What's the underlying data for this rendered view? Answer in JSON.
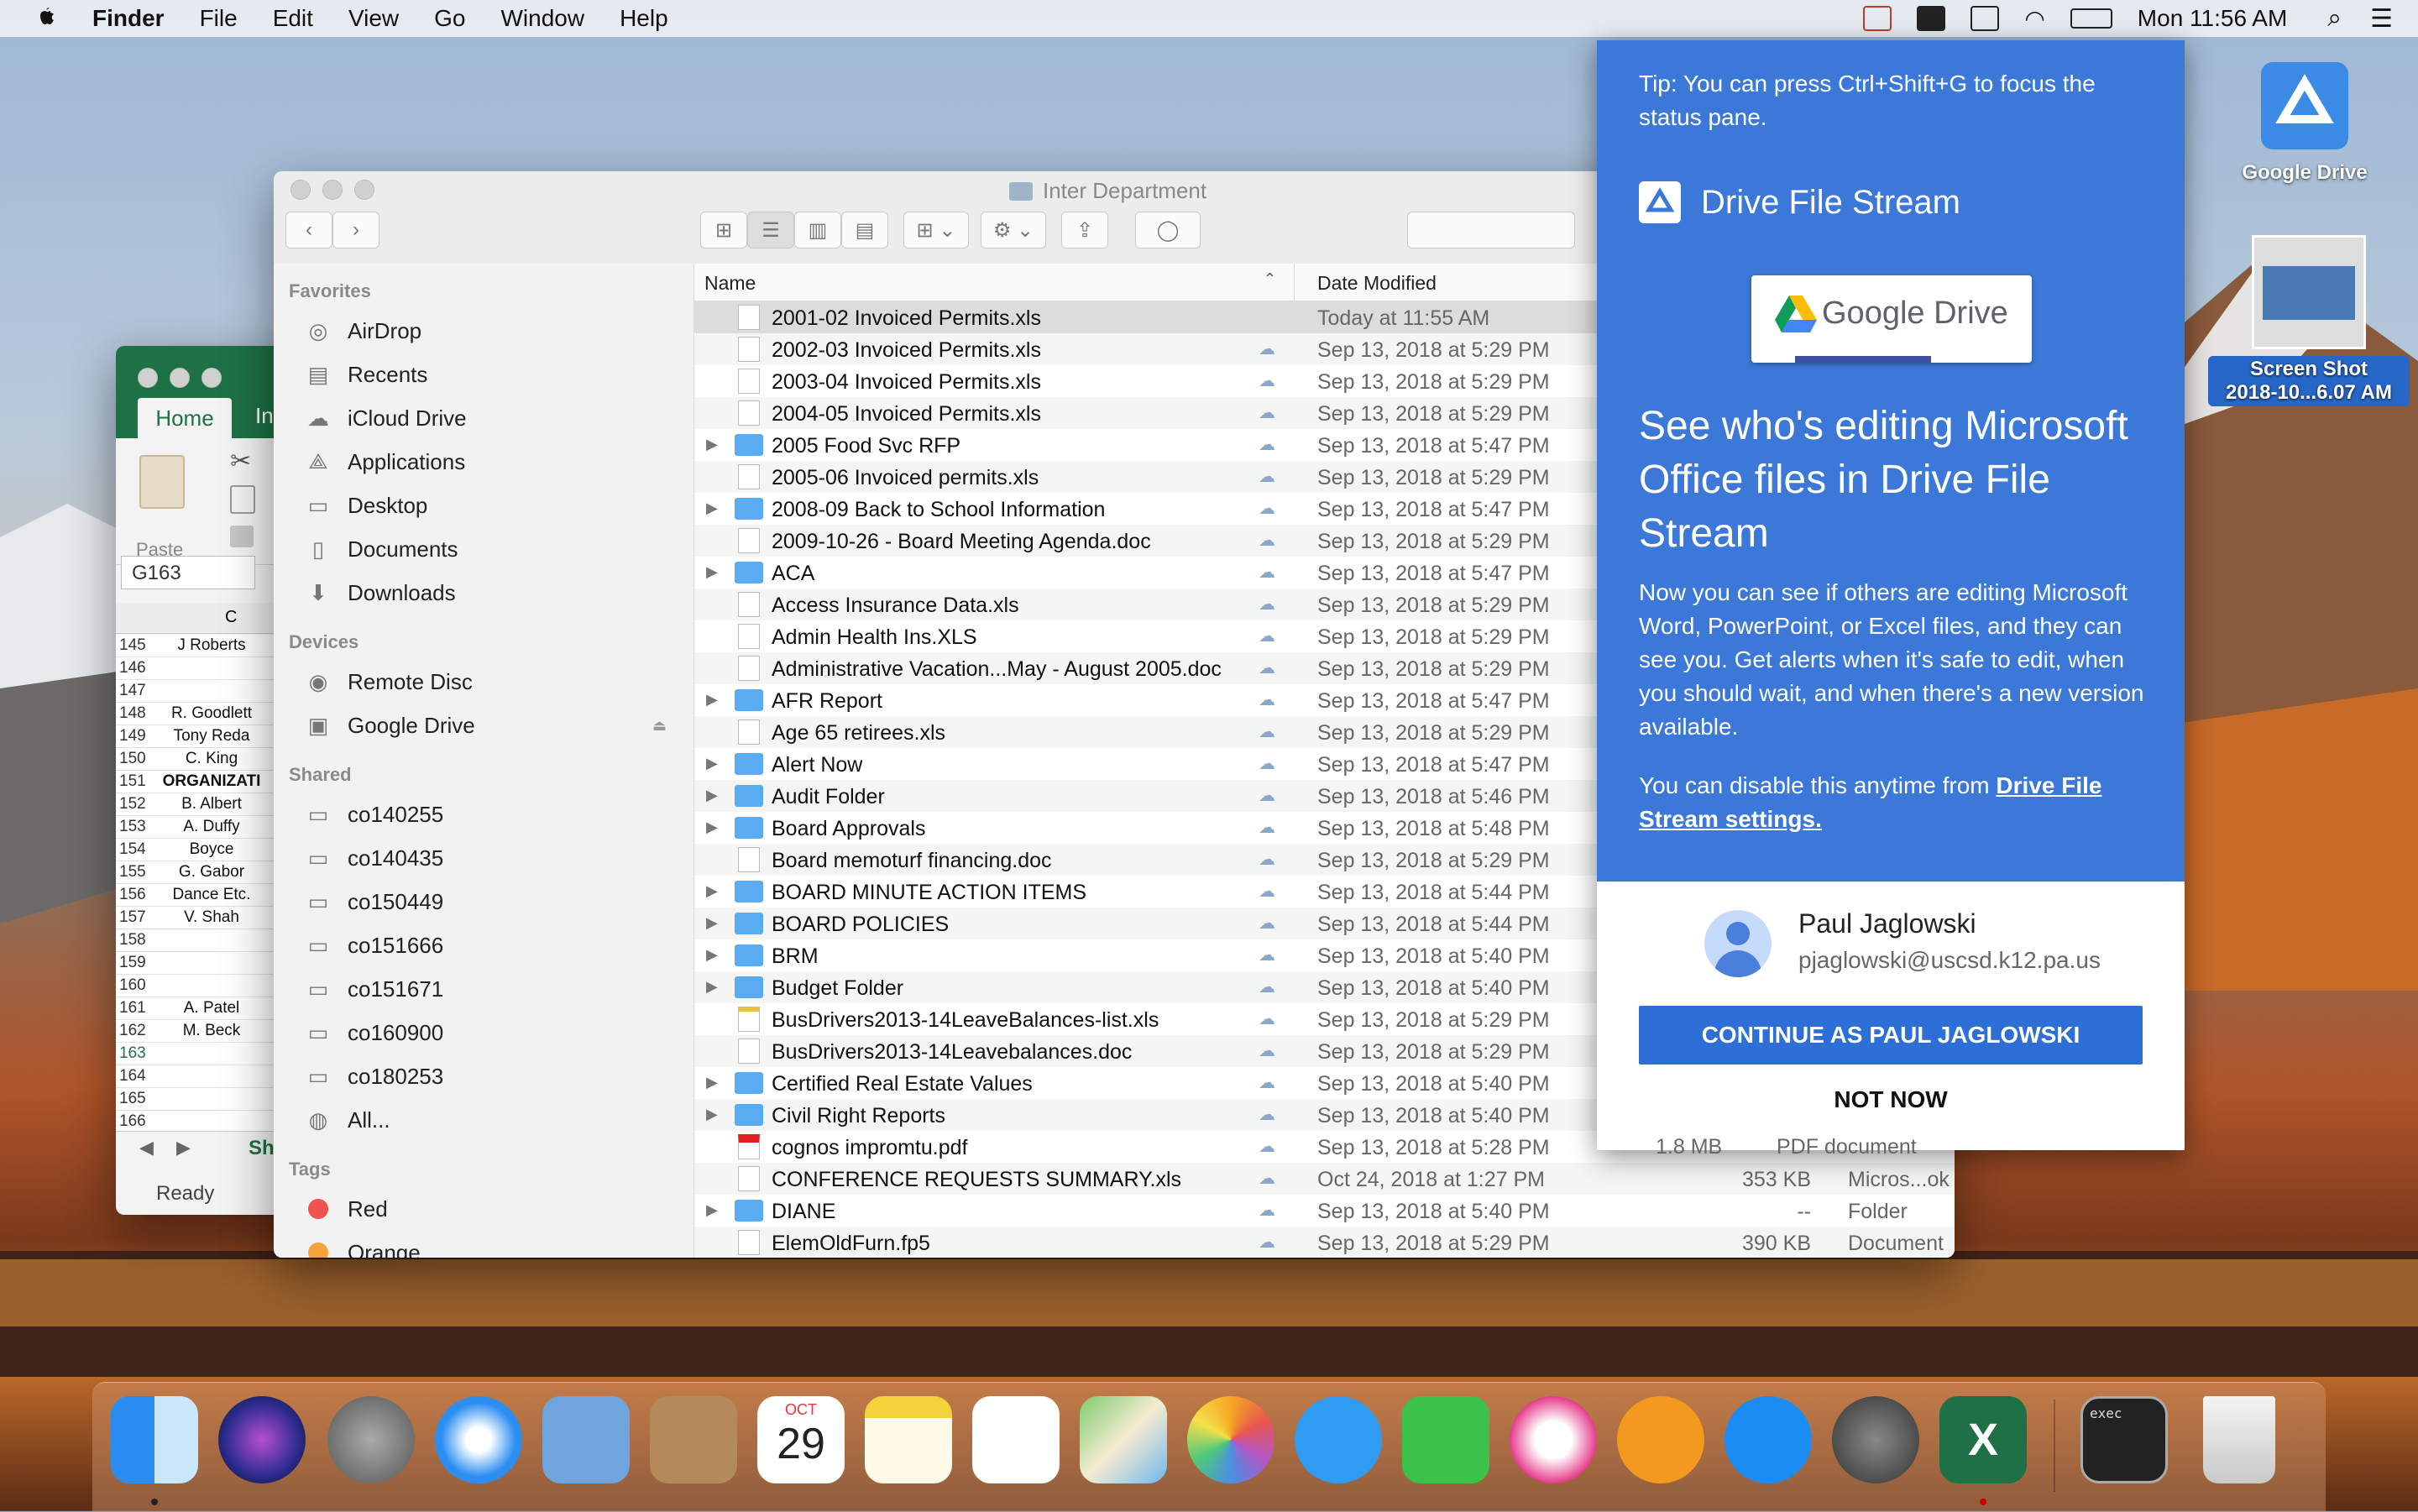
{
  "menubar": {
    "app_name": "Finder",
    "items": [
      "File",
      "Edit",
      "View",
      "Go",
      "Window",
      "Help"
    ],
    "clock": "Mon 11:56 AM",
    "tray_icons": [
      "google-drive-error-icon",
      "google-drive-icon",
      "airplay-icon",
      "wifi-icon",
      "battery-icon",
      "spotlight-icon",
      "notification-center-icon"
    ]
  },
  "excel": {
    "tab_home": "Home",
    "tab_next": "In",
    "paste_label": "Paste",
    "name_box": "G163",
    "column": "C",
    "rows": [
      {
        "n": "145",
        "v": "J Roberts",
        "b": false
      },
      {
        "n": "146",
        "v": "",
        "b": false
      },
      {
        "n": "147",
        "v": "",
        "b": false
      },
      {
        "n": "148",
        "v": "R. Goodlett",
        "b": false
      },
      {
        "n": "149",
        "v": "Tony Reda",
        "b": false
      },
      {
        "n": "150",
        "v": "C. King",
        "b": false
      },
      {
        "n": "151",
        "v": "ORGANIZATI",
        "b": true
      },
      {
        "n": "152",
        "v": "B. Albert",
        "b": false
      },
      {
        "n": "153",
        "v": "A. Duffy",
        "b": false
      },
      {
        "n": "154",
        "v": "Boyce",
        "b": false
      },
      {
        "n": "155",
        "v": "G. Gabor",
        "b": false
      },
      {
        "n": "156",
        "v": "Dance Etc.",
        "b": false
      },
      {
        "n": "157",
        "v": "V. Shah",
        "b": false
      },
      {
        "n": "158",
        "v": "",
        "b": false
      },
      {
        "n": "159",
        "v": "",
        "b": false
      },
      {
        "n": "160",
        "v": "",
        "b": false
      },
      {
        "n": "161",
        "v": "A. Patel",
        "b": false
      },
      {
        "n": "162",
        "v": "M. Beck",
        "b": false
      },
      {
        "n": "163",
        "v": "",
        "b": false
      },
      {
        "n": "164",
        "v": "",
        "b": false
      },
      {
        "n": "165",
        "v": "",
        "b": false
      },
      {
        "n": "166",
        "v": "",
        "b": false
      },
      {
        "n": "167",
        "v": "",
        "b": false
      }
    ],
    "sheet_tab": "Sh",
    "status": "Ready"
  },
  "finder": {
    "title": "Inter Department",
    "col_name": "Name",
    "col_date": "Date Modified",
    "sidebar": {
      "favorites_head": "Favorites",
      "favorites": [
        {
          "label": "AirDrop",
          "icon": "airdrop-icon"
        },
        {
          "label": "Recents",
          "icon": "recents-icon"
        },
        {
          "label": "iCloud Drive",
          "icon": "icloud-icon"
        },
        {
          "label": "Applications",
          "icon": "applications-icon"
        },
        {
          "label": "Desktop",
          "icon": "desktop-icon"
        },
        {
          "label": "Documents",
          "icon": "documents-icon"
        },
        {
          "label": "Downloads",
          "icon": "downloads-icon"
        }
      ],
      "devices_head": "Devices",
      "devices": [
        {
          "label": "Remote Disc",
          "icon": "disc-icon"
        },
        {
          "label": "Google Drive",
          "icon": "drive-icon"
        }
      ],
      "shared_head": "Shared",
      "shared": [
        {
          "label": "co140255",
          "icon": "computer-icon"
        },
        {
          "label": "co140435",
          "icon": "computer-icon"
        },
        {
          "label": "co150449",
          "icon": "computer-icon"
        },
        {
          "label": "co151666",
          "icon": "computer-icon"
        },
        {
          "label": "co151671",
          "icon": "computer-icon"
        },
        {
          "label": "co160900",
          "icon": "computer-icon"
        },
        {
          "label": "co180253",
          "icon": "computer-icon"
        },
        {
          "label": "All...",
          "icon": "network-icon"
        }
      ],
      "tags_head": "Tags",
      "tags": [
        {
          "label": "Red",
          "color": "#f0524f"
        },
        {
          "label": "Orange",
          "color": "#f5a33a"
        }
      ]
    },
    "files": [
      {
        "name": "2001-02 Invoiced Permits.xls",
        "type": "file",
        "date": "Today at 11:55 AM",
        "size": "",
        "kind": "",
        "folder": false
      },
      {
        "name": "2002-03 Invoiced Permits.xls",
        "type": "file",
        "date": "Sep 13, 2018 at 5:29 PM",
        "size": "",
        "kind": "",
        "folder": false
      },
      {
        "name": "2003-04 Invoiced Permits.xls",
        "type": "file",
        "date": "Sep 13, 2018 at 5:29 PM",
        "size": "",
        "kind": "",
        "folder": false
      },
      {
        "name": "2004-05 Invoiced Permits.xls",
        "type": "file",
        "date": "Sep 13, 2018 at 5:29 PM",
        "size": "",
        "kind": "",
        "folder": false
      },
      {
        "name": "2005 Food Svc RFP",
        "type": "folder",
        "date": "Sep 13, 2018 at 5:47 PM",
        "size": "",
        "kind": "",
        "folder": true
      },
      {
        "name": "2005-06 Invoiced permits.xls",
        "type": "file",
        "date": "Sep 13, 2018 at 5:29 PM",
        "size": "",
        "kind": "",
        "folder": false
      },
      {
        "name": "2008-09 Back to School Information",
        "type": "folder",
        "date": "Sep 13, 2018 at 5:47 PM",
        "size": "",
        "kind": "",
        "folder": true
      },
      {
        "name": "2009-10-26 - Board Meeting Agenda.doc",
        "type": "file",
        "date": "Sep 13, 2018 at 5:29 PM",
        "size": "",
        "kind": "",
        "folder": false
      },
      {
        "name": "ACA",
        "type": "folder",
        "date": "Sep 13, 2018 at 5:47 PM",
        "size": "",
        "kind": "",
        "folder": true
      },
      {
        "name": "Access Insurance Data.xls",
        "type": "file",
        "date": "Sep 13, 2018 at 5:29 PM",
        "size": "",
        "kind": "",
        "folder": false
      },
      {
        "name": "Admin Health Ins.XLS",
        "type": "file",
        "date": "Sep 13, 2018 at 5:29 PM",
        "size": "",
        "kind": "",
        "folder": false
      },
      {
        "name": "Administrative Vacation...May - August 2005.doc",
        "type": "file",
        "date": "Sep 13, 2018 at 5:29 PM",
        "size": "",
        "kind": "",
        "folder": false
      },
      {
        "name": "AFR Report",
        "type": "folder",
        "date": "Sep 13, 2018 at 5:47 PM",
        "size": "",
        "kind": "",
        "folder": true
      },
      {
        "name": "Age 65 retirees.xls",
        "type": "file",
        "date": "Sep 13, 2018 at 5:29 PM",
        "size": "",
        "kind": "",
        "folder": false
      },
      {
        "name": "Alert Now",
        "type": "folder",
        "date": "Sep 13, 2018 at 5:47 PM",
        "size": "",
        "kind": "",
        "folder": true
      },
      {
        "name": "Audit Folder",
        "type": "folder",
        "date": "Sep 13, 2018 at 5:46 PM",
        "size": "",
        "kind": "",
        "folder": true
      },
      {
        "name": "Board Approvals",
        "type": "folder",
        "date": "Sep 13, 2018 at 5:48 PM",
        "size": "",
        "kind": "",
        "folder": true
      },
      {
        "name": "Board memoturf financing.doc",
        "type": "file",
        "date": "Sep 13, 2018 at 5:29 PM",
        "size": "",
        "kind": "",
        "folder": false
      },
      {
        "name": "BOARD MINUTE ACTION ITEMS",
        "type": "folder",
        "date": "Sep 13, 2018 at 5:44 PM",
        "size": "",
        "kind": "",
        "folder": true
      },
      {
        "name": "BOARD POLICIES",
        "type": "folder",
        "date": "Sep 13, 2018 at 5:44 PM",
        "size": "",
        "kind": "",
        "folder": true
      },
      {
        "name": "BRM",
        "type": "folder",
        "date": "Sep 13, 2018 at 5:40 PM",
        "size": "",
        "kind": "",
        "folder": true
      },
      {
        "name": "Budget Folder",
        "type": "folder",
        "date": "Sep 13, 2018 at 5:40 PM",
        "size": "",
        "kind": "",
        "folder": true
      },
      {
        "name": "BusDrivers2013-14LeaveBalances-list.xls",
        "type": "xls",
        "date": "Sep 13, 2018 at 5:29 PM",
        "size": "",
        "kind": "",
        "folder": false
      },
      {
        "name": "BusDrivers2013-14Leavebalances.doc",
        "type": "file",
        "date": "Sep 13, 2018 at 5:29 PM",
        "size": "",
        "kind": "",
        "folder": false
      },
      {
        "name": "Certified Real Estate Values",
        "type": "folder",
        "date": "Sep 13, 2018 at 5:40 PM",
        "size": "",
        "kind": "",
        "folder": true
      },
      {
        "name": "Civil Right Reports",
        "type": "folder",
        "date": "Sep 13, 2018 at 5:40 PM",
        "size": "",
        "kind": "",
        "folder": true
      },
      {
        "name": "cognos impromtu.pdf",
        "type": "pdf",
        "date": "Sep 13, 2018 at 5:28 PM",
        "size": "",
        "kind": "",
        "folder": false
      },
      {
        "name": "CONFERENCE REQUESTS SUMMARY.xls",
        "type": "file",
        "date": "Oct 24, 2018 at 1:27 PM",
        "size": "353 KB",
        "kind": "Micros...ok (.xls)",
        "folder": false
      },
      {
        "name": "DIANE",
        "type": "folder",
        "date": "Sep 13, 2018 at 5:40 PM",
        "size": "--",
        "kind": "Folder",
        "folder": true
      },
      {
        "name": "ElemOldFurn.fp5",
        "type": "file",
        "date": "Sep 13, 2018 at 5:29 PM",
        "size": "390 KB",
        "kind": "Document",
        "folder": false
      }
    ]
  },
  "drive_popup": {
    "tip": "Tip: You can press Ctrl+Shift+G to focus the status pane.",
    "brand": "Drive File Stream",
    "card_text": "Google Drive",
    "headline": "See who's editing Microsoft Office files in Drive File Stream",
    "body": "Now you can see if others are editing Microsoft Word, PowerPoint, or Excel files, and they can see you. Get alerts when it's safe to edit, when you should wait, and when there's a new version available.",
    "disable_prefix": "You can disable this anytime from ",
    "disable_link": "Drive File Stream settings.",
    "user_name": "Paul Jaglowski",
    "user_email": "pjaglowski@uscsd.k12.pa.us",
    "continue_label": "CONTINUE AS PAUL JAGLOWSKI",
    "not_now_label": "NOT NOW",
    "hidden_kind": "PDF document",
    "hidden_size": "1.8 MB"
  },
  "desktop": {
    "drive_label": "Google Drive",
    "screenshot_label_1": "Screen Shot",
    "screenshot_label_2": "2018-10...6.07 AM"
  },
  "dock": {
    "calendar_month": "OCT",
    "calendar_day": "29",
    "terminal_label": "exec",
    "apps": [
      "finder-icon",
      "siri-icon",
      "launchpad-icon",
      "safari-icon",
      "mail-icon",
      "contacts-icon",
      "calendar-icon",
      "notes-icon",
      "reminders-icon",
      "maps-icon",
      "photos-icon",
      "messages-icon",
      "facetime-icon",
      "itunes-icon",
      "ibooks-icon",
      "app-store-icon",
      "system-preferences-icon",
      "excel-icon",
      "terminal-icon",
      "trash-icon"
    ]
  }
}
